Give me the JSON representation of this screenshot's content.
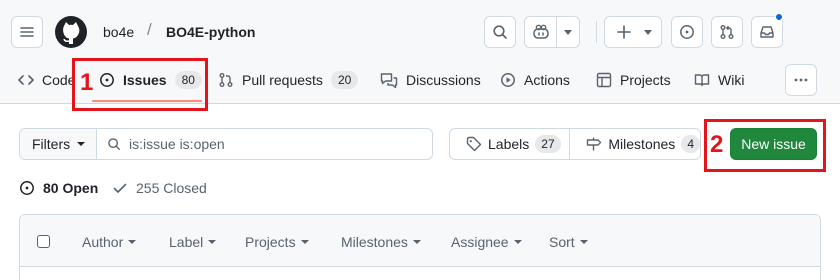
{
  "header": {
    "owner": "bo4e",
    "separator": "/",
    "repo": "BO4E-python",
    "icons": [
      "menu-icon",
      "github-logo-icon",
      "search-icon",
      "copilot-icon",
      "chevron-down-icon",
      "plus-icon",
      "chevron-down-icon",
      "issue-opened-icon",
      "pull-request-icon",
      "inbox-icon"
    ]
  },
  "tabs": {
    "code": {
      "label": "Code"
    },
    "issues": {
      "label": "Issues",
      "count": "80"
    },
    "pulls": {
      "label": "Pull requests",
      "count": "20"
    },
    "discussions": {
      "label": "Discussions"
    },
    "actions": {
      "label": "Actions"
    },
    "projects": {
      "label": "Projects"
    },
    "wiki": {
      "label": "Wiki"
    }
  },
  "toolbar": {
    "filters_label": "Filters",
    "query": "is:issue is:open",
    "labels_label": "Labels",
    "labels_count": "27",
    "milestones_label": "Milestones",
    "milestones_count": "4",
    "new_issue_label": "New issue"
  },
  "states": {
    "open": "80 Open",
    "closed": "255 Closed"
  },
  "columns": {
    "author": "Author",
    "label": "Label",
    "projects": "Projects",
    "milestones": "Milestones",
    "assignee": "Assignee",
    "sort": "Sort"
  },
  "annotations": {
    "one": "1",
    "two": "2",
    "color": "#e5141b"
  },
  "colors": {
    "accent_green": "#1f883d",
    "tab_underline": "#fd8c73",
    "notification_dot": "#0969da"
  }
}
